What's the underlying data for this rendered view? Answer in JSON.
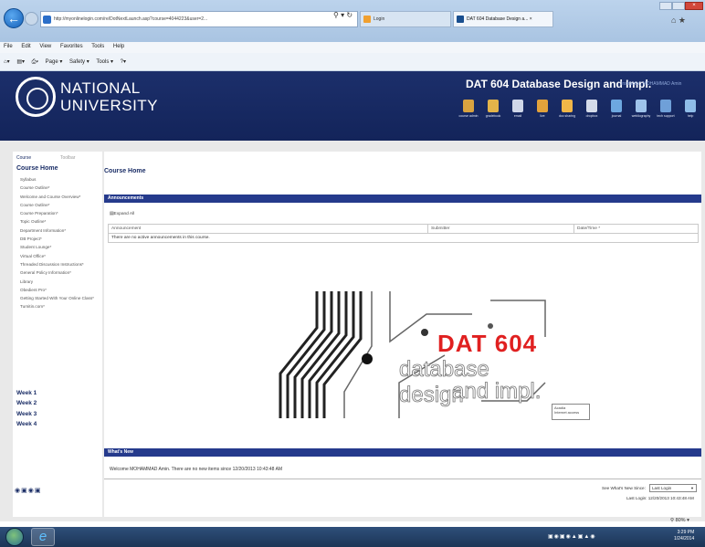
{
  "browser": {
    "url": "http://myonlinelogin.com/re/DotNextLaunch.asp?course=4044223&user=2...",
    "tab1": "Login",
    "tab2": "DAT 604 Database Design a...",
    "menu": [
      "File",
      "Edit",
      "View",
      "Favorites",
      "Tools",
      "Help"
    ],
    "commands": [
      "Page ▾",
      "Safety ▾",
      "Tools ▾",
      "?▾"
    ],
    "zoom": "80%"
  },
  "header": {
    "brand_line1": "NATIONAL",
    "brand_line2": "UNIVERSITY",
    "course_title": "DAT 604 Database Design and Impl.",
    "instructor": "Instructor: MOHAMMAD Amin",
    "tools": [
      {
        "label": "course admin",
        "icon": "course-admin-icon",
        "color": "#d9a340"
      },
      {
        "label": "gradebook",
        "icon": "gradebook-icon",
        "color": "#e3b44a"
      },
      {
        "label": "email",
        "icon": "email-icon",
        "color": "#cfd7e8"
      },
      {
        "label": "live",
        "icon": "live-icon",
        "color": "#e2a23b"
      },
      {
        "label": "doc sharing",
        "icon": "doc-sharing-icon",
        "color": "#f0b648"
      },
      {
        "label": "dropbox",
        "icon": "dropbox-icon",
        "color": "#d4dbe9"
      },
      {
        "label": "journal",
        "icon": "journal-icon",
        "color": "#6da8e0"
      },
      {
        "label": "webliography",
        "icon": "webliography-icon",
        "color": "#9ec3ea"
      },
      {
        "label": "tech support",
        "icon": "tech-support-icon",
        "color": "#6fa0d8"
      },
      {
        "label": "help",
        "icon": "help-icon",
        "color": "#8fbde8"
      }
    ]
  },
  "sidebar": {
    "tab_course": "Course",
    "tab_toolbar": "Toolbar",
    "home": "Course Home",
    "items": [
      "Syllabus",
      "Course Outline*",
      "Welcome and Course Overview*",
      "Course Outline*",
      "Course Preparation*",
      "Topic Outline*",
      "Department Information*",
      "DB Project*",
      "Student Lounge*",
      "Virtual Office*",
      "Threaded Discussion Instructions*",
      "General Policy Information*",
      "Library",
      "Obedient Pro*",
      "Getting Started With Your Online Class*",
      "Turnitin.com*"
    ],
    "weeks": [
      "Week 1",
      "Week 2",
      "Week 3",
      "Week 4"
    ]
  },
  "main": {
    "title": "Course Home",
    "announcements_bar": "Announcements",
    "expand_all": "Expand All",
    "table_headers": [
      "Announcement",
      "Submitter",
      "Date/Time *"
    ],
    "no_announcements": "There are no active announcements in this course.",
    "banner_line1": "DAT 604",
    "banner_line2": "database design",
    "banner_line3": "and impl.",
    "tooltip_line1": "Acadia",
    "tooltip_line2": "Internet access",
    "whats_new_bar": "What's New",
    "whats_new_msg": "Welcome MOHAMMAD Amin. There are no new items since 12/20/2013 10:43:48 AM",
    "see_label": "See What's New Since:",
    "since_value": "Last Login",
    "last_login": "Last Login: 12/20/2013 10:43:48 AM"
  },
  "taskbar": {
    "time": "3:29 PM",
    "date": "1/24/2014"
  }
}
